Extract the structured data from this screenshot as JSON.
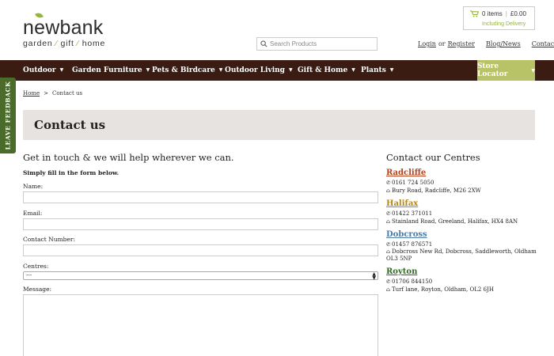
{
  "brand": {
    "name": "newbank",
    "tag_1": "garden",
    "tag_2": "gift",
    "tag_3": "home",
    "leaf_color": "#97b43b"
  },
  "search": {
    "placeholder": "Search Products"
  },
  "cart": {
    "items": "0 items",
    "total": "£0.00",
    "note": "Including Delivery"
  },
  "toplinks": {
    "login": "Login",
    "or": "or",
    "register": "Register",
    "blog": "Blog/News",
    "contact": "Contact Us"
  },
  "nav": {
    "items": [
      {
        "label": "Outdoor"
      },
      {
        "label": "Garden Furniture"
      },
      {
        "label": "Pets & Birdcare"
      },
      {
        "label": "Outdoor Living"
      },
      {
        "label": "Gift & Home"
      },
      {
        "label": "Plants"
      }
    ],
    "store_locator": "Store Locator",
    "bg_color": "#3a1c12",
    "store_color": "#b8c267"
  },
  "feedback": {
    "label": "LEAVE FEEDBACK"
  },
  "breadcrumb": {
    "home": "Home",
    "sep": ">",
    "current": "Contact us"
  },
  "page": {
    "title": "Contact us"
  },
  "form": {
    "intro": "Get in touch & we will help wherever we can.",
    "sub": "Simply fill in the form below.",
    "name_label": "Name:",
    "email_label": "Email:",
    "phone_label": "Contact Number:",
    "centres_label": "Centres:",
    "centres_selected": "---",
    "message_label": "Message:"
  },
  "centres": {
    "title": "Contact our Centres",
    "list": [
      {
        "name": "Radcliffe",
        "phone": "0161 724 5050",
        "address": "Bury Road, Radcliffe, M26 2XW",
        "color": "#b5421d"
      },
      {
        "name": "Halifax",
        "phone": "01422 371011",
        "address": "Stainland Road, Greeland, Halifax, HX4 8AN",
        "color": "#b8860b"
      },
      {
        "name": "Dobcross",
        "phone": "01457 876571",
        "address": "Dobcross New Rd, Dobcross, Saddleworth, Oldham",
        "address_2": "OL3 5NP",
        "color": "#4a79a5"
      },
      {
        "name": "Royton",
        "phone": "01706 844150",
        "address": "Turf lane, Royton, Oldham, OL2 6JH",
        "color": "#2e6b1f"
      }
    ]
  }
}
